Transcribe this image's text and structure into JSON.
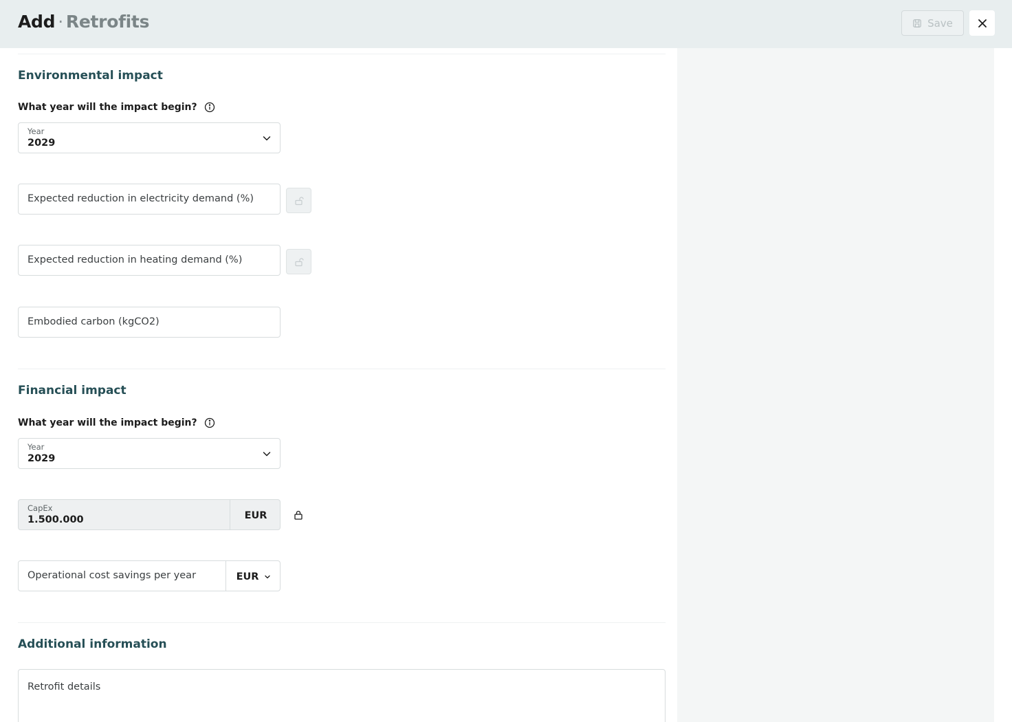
{
  "header": {
    "title": "Add",
    "separator": "·",
    "subtitle": "Retrofits",
    "save_label": "Save",
    "save_icon": "save-icon",
    "close_icon": "close-icon"
  },
  "environmental": {
    "section_title": "Environmental impact",
    "question": "What year will the impact begin?",
    "year_label": "Year",
    "year_value": "2029",
    "electricity_placeholder": "Expected reduction in electricity demand (%)",
    "heating_placeholder": "Expected reduction in heating demand (%)",
    "carbon_placeholder": "Embodied carbon (kgCO2)"
  },
  "financial": {
    "section_title": "Financial impact",
    "question": "What year will the impact begin?",
    "year_label": "Year",
    "year_value": "2029",
    "capex_label": "CapEx",
    "capex_value": "1.500.000",
    "capex_currency": "EUR",
    "opex_placeholder": "Operational cost savings per year",
    "opex_currency": "EUR"
  },
  "additional": {
    "section_title": "Additional information",
    "details_placeholder": "Retrofit details"
  },
  "colors": {
    "header_bg": "#e8eeef",
    "section_title": "#264f56",
    "side_panel_bg": "#f4f6f6"
  }
}
